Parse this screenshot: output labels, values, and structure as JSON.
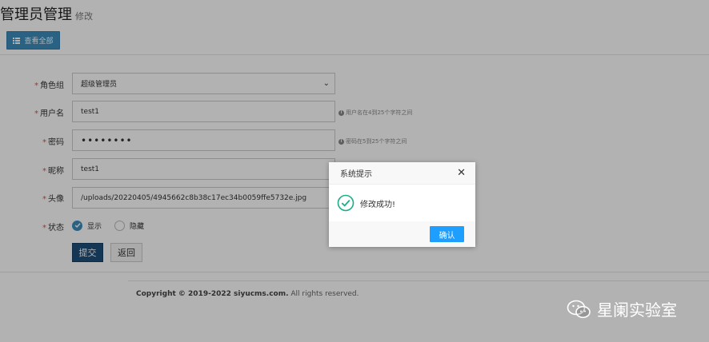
{
  "header": {
    "title": "管理员管理",
    "subtitle": "修改"
  },
  "toolbar": {
    "view_all_label": "查看全部"
  },
  "form": {
    "role": {
      "label": "角色组",
      "value": "超级管理员"
    },
    "username": {
      "label": "用户名",
      "value": "test1",
      "help": "用户名在4到25个字符之间"
    },
    "password": {
      "label": "密码",
      "value": "••••••••",
      "help": "密码在5到25个字符之间"
    },
    "nickname": {
      "label": "昵称",
      "value": "test1"
    },
    "avatar": {
      "label": "头像",
      "value": "/uploads/20220405/4945662c8b38c17ec34b0059ffe5732e.jpg"
    },
    "status": {
      "label": "状态",
      "options": [
        "显示",
        "隐藏"
      ],
      "selected": "显示"
    },
    "required_mark": "*",
    "submit_label": "提交",
    "back_label": "返回"
  },
  "footer": {
    "copyright": "Copyright © 2019-2022 siyucms.com.",
    "rights": " All rights reserved."
  },
  "dialog": {
    "title": "系统提示",
    "message": "修改成功!",
    "confirm_label": "确认",
    "close_glyph": "✕"
  },
  "watermark": {
    "text": "星阑实验室"
  },
  "colors": {
    "primary": "#3c8dbc",
    "submit": "#1e4f7a",
    "confirm": "#1e9fff",
    "success": "#1aad8a",
    "required": "#d9534f"
  }
}
